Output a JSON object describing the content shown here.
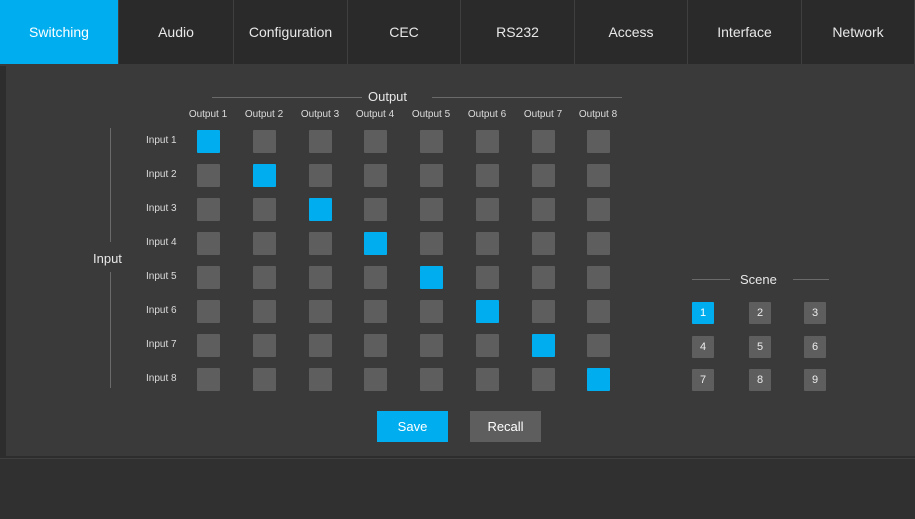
{
  "tabs": [
    {
      "label": "Switching",
      "active": true
    },
    {
      "label": "Audio",
      "active": false
    },
    {
      "label": "Configuration",
      "active": false
    },
    {
      "label": "CEC",
      "active": false
    },
    {
      "label": "RS232",
      "active": false
    },
    {
      "label": "Access",
      "active": false
    },
    {
      "label": "Interface",
      "active": false
    },
    {
      "label": "Network",
      "active": false
    }
  ],
  "matrix": {
    "output_title": "Output",
    "input_title": "Input",
    "outputs": [
      "Output 1",
      "Output 2",
      "Output 3",
      "Output 4",
      "Output 5",
      "Output 6",
      "Output 7",
      "Output 8"
    ],
    "inputs": [
      "Input 1",
      "Input 2",
      "Input 3",
      "Input 4",
      "Input 5",
      "Input 6",
      "Input 7",
      "Input 8"
    ],
    "active_input_for_output": [
      1,
      2,
      3,
      4,
      5,
      6,
      7,
      8
    ]
  },
  "actions": {
    "save_label": "Save",
    "recall_label": "Recall"
  },
  "scene": {
    "title": "Scene",
    "buttons": [
      "1",
      "2",
      "3",
      "4",
      "5",
      "6",
      "7",
      "8",
      "9"
    ],
    "active": "1"
  },
  "colors": {
    "accent": "#00aeef",
    "cell": "#5e5e5e",
    "panel": "#3a3a3a"
  }
}
